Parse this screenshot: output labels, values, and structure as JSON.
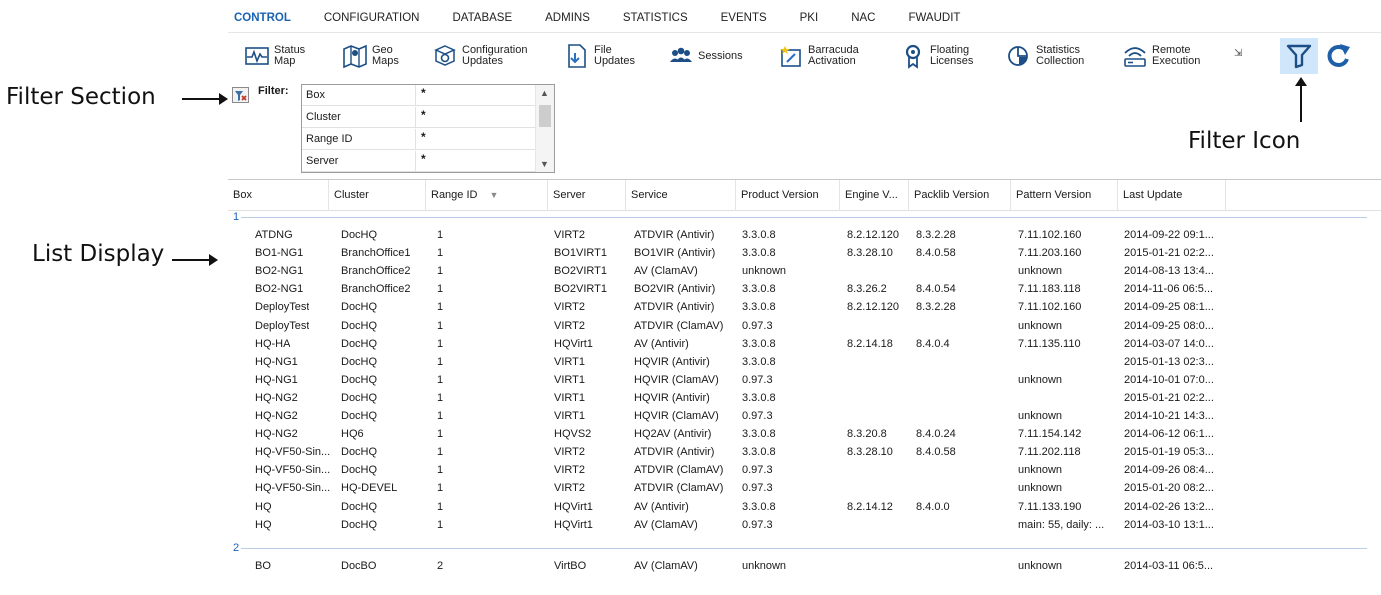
{
  "nav": {
    "tabs": [
      {
        "label": "CONTROL",
        "active": true
      },
      {
        "label": "CONFIGURATION"
      },
      {
        "label": "DATABASE"
      },
      {
        "label": "ADMINS"
      },
      {
        "label": "STATISTICS"
      },
      {
        "label": "EVENTS"
      },
      {
        "label": "PKI"
      },
      {
        "label": "NAC"
      },
      {
        "label": "FWAUDIT"
      }
    ]
  },
  "ribbon": {
    "items": [
      {
        "label": "Status\nMap",
        "icon": "status-map-icon"
      },
      {
        "label": "Geo\nMaps",
        "icon": "geo-maps-icon"
      },
      {
        "label": "Configuration\nUpdates",
        "icon": "configuration-updates-icon"
      },
      {
        "label": "File\nUpdates",
        "icon": "file-updates-icon"
      },
      {
        "label": "Sessions",
        "icon": "sessions-icon"
      },
      {
        "label": "Barracuda\nActivation",
        "icon": "barracuda-activation-icon"
      },
      {
        "label": "Floating\nLicenses",
        "icon": "floating-licenses-icon"
      },
      {
        "label": "Statistics\nCollection",
        "icon": "statistics-collection-icon"
      },
      {
        "label": "Remote\nExecution",
        "icon": "remote-execution-icon"
      }
    ],
    "filter_icon": "filter-funnel-icon",
    "refresh_icon": "refresh-icon"
  },
  "annotations": {
    "filter_section": "Filter Section",
    "filter_icon": "Filter Icon",
    "list_display": "List Display"
  },
  "filter": {
    "label": "Filter:",
    "rows": [
      {
        "name": "Box",
        "value": "*"
      },
      {
        "name": "Cluster",
        "value": "*"
      },
      {
        "name": "Range ID",
        "value": "*"
      },
      {
        "name": "Server",
        "value": "*"
      }
    ]
  },
  "list": {
    "columns": [
      "Box",
      "Cluster",
      "Range ID",
      "Server",
      "Service",
      "Product Version",
      "Engine V...",
      "Packlib Version",
      "Pattern Version",
      "Last Update"
    ],
    "groups": [
      {
        "label": "1",
        "rows": [
          [
            "ATDNG",
            "DocHQ",
            "1",
            "VIRT2",
            "ATDVIR (Antivir)",
            "3.3.0.8",
            "8.2.12.120",
            "8.3.2.28",
            "7.11.102.160",
            "2014-09-22 09:1..."
          ],
          [
            "BO1-NG1",
            "BranchOffice1",
            "1",
            "BO1VIRT1",
            "BO1VIR (Antivir)",
            "3.3.0.8",
            "8.3.28.10",
            "8.4.0.58",
            "7.11.203.160",
            "2015-01-21 02:2..."
          ],
          [
            "BO2-NG1",
            "BranchOffice2",
            "1",
            "BO2VIRT1",
            "AV (ClamAV)",
            "unknown",
            "",
            "",
            "unknown",
            "2014-08-13 13:4..."
          ],
          [
            "BO2-NG1",
            "BranchOffice2",
            "1",
            "BO2VIRT1",
            "BO2VIR (Antivir)",
            "3.3.0.8",
            "8.3.26.2",
            "8.4.0.54",
            "7.11.183.118",
            "2014-11-06 06:5..."
          ],
          [
            "DeployTest",
            "DocHQ",
            "1",
            "VIRT2",
            "ATDVIR (Antivir)",
            "3.3.0.8",
            "8.2.12.120",
            "8.3.2.28",
            "7.11.102.160",
            "2014-09-25 08:1..."
          ],
          [
            "DeployTest",
            "DocHQ",
            "1",
            "VIRT2",
            "ATDVIR (ClamAV)",
            "0.97.3",
            "",
            "",
            "unknown",
            "2014-09-25 08:0..."
          ],
          [
            "HQ-HA",
            "DocHQ",
            "1",
            "HQVirt1",
            "AV (Antivir)",
            "3.3.0.8",
            "8.2.14.18",
            "8.4.0.4",
            "7.11.135.110",
            "2014-03-07 14:0..."
          ],
          [
            "HQ-NG1",
            "DocHQ",
            "1",
            "VIRT1",
            "HQVIR (Antivir)",
            "3.3.0.8",
            "",
            "",
            "",
            "2015-01-13 02:3..."
          ],
          [
            "HQ-NG1",
            "DocHQ",
            "1",
            "VIRT1",
            "HQVIR (ClamAV)",
            "0.97.3",
            "",
            "",
            "unknown",
            "2014-10-01 07:0..."
          ],
          [
            "HQ-NG2",
            "DocHQ",
            "1",
            "VIRT1",
            "HQVIR (Antivir)",
            "3.3.0.8",
            "",
            "",
            "",
            "2015-01-21 02:2..."
          ],
          [
            "HQ-NG2",
            "DocHQ",
            "1",
            "VIRT1",
            "HQVIR (ClamAV)",
            "0.97.3",
            "",
            "",
            "unknown",
            "2014-10-21 14:3..."
          ],
          [
            "HQ-NG2",
            "HQ6",
            "1",
            "HQVS2",
            "HQ2AV (Antivir)",
            "3.3.0.8",
            "8.3.20.8",
            "8.4.0.24",
            "7.11.154.142",
            "2014-06-12 06:1..."
          ],
          [
            "HQ-VF50-Sin...",
            "DocHQ",
            "1",
            "VIRT2",
            "ATDVIR (Antivir)",
            "3.3.0.8",
            "8.3.28.10",
            "8.4.0.58",
            "7.11.202.118",
            "2015-01-19 05:3..."
          ],
          [
            "HQ-VF50-Sin...",
            "DocHQ",
            "1",
            "VIRT2",
            "ATDVIR (ClamAV)",
            "0.97.3",
            "",
            "",
            "unknown",
            "2014-09-26 08:4..."
          ],
          [
            "HQ-VF50-Sin...",
            "HQ-DEVEL",
            "1",
            "VIRT2",
            "ATDVIR (ClamAV)",
            "0.97.3",
            "",
            "",
            "unknown",
            "2015-01-20 08:2..."
          ],
          [
            "HQ",
            "DocHQ",
            "1",
            "HQVirt1",
            "AV (Antivir)",
            "3.3.0.8",
            "8.2.14.12",
            "8.4.0.0",
            "7.11.133.190",
            "2014-02-26 13:2..."
          ],
          [
            "HQ",
            "DocHQ",
            "1",
            "HQVirt1",
            "AV (ClamAV)",
            "0.97.3",
            "",
            "",
            "main: 55, daily: ...",
            "2014-03-10 13:1..."
          ]
        ]
      },
      {
        "label": "2",
        "rows": [
          [
            "BO",
            "DocBO",
            "2",
            "VirtBO",
            "AV (ClamAV)",
            "unknown",
            "",
            "",
            "unknown",
            "2014-03-11 06:5..."
          ]
        ]
      }
    ]
  }
}
